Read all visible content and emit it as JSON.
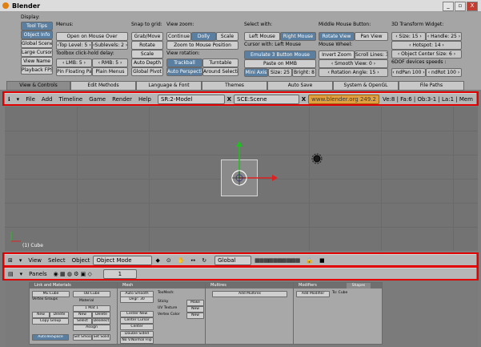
{
  "window": {
    "title": "Blender",
    "buttons": [
      "_",
      "▫",
      "X"
    ]
  },
  "prefs": {
    "display": {
      "label": "Display:",
      "items": [
        "Tool Tips",
        "Object Info",
        "Global Scene",
        "Large Cursors",
        "View Name",
        "Playback FPS"
      ]
    },
    "menus": {
      "label": "Menus:",
      "open_on_mouse_over": "Open on Mouse Over",
      "top_level": "‹Top Level: 5 ›",
      "sublevels": "‹Sublevels: 2 ›",
      "toolbox_label": "Toolbox click-hold delay:",
      "lmb": "‹ LMB: 5 ›",
      "rmb": "‹ RMB: 5 ›",
      "pin_floating": "Pin Floating Pa",
      "plain_menus": "Plain Menus"
    },
    "snap": {
      "label": "Snap to grid:",
      "items": [
        "Grab/Move",
        "Rotate",
        "Scale"
      ],
      "auto_depth": "Auto Depth",
      "global_pivot": "Global Pivot"
    },
    "view_zoom": {
      "label": "View zoom:",
      "items": [
        "Continue",
        "Dolly",
        "Scale"
      ],
      "zoom_to_mouse": "Zoom to Mouse Position",
      "rotation_label": "View rotation:",
      "trackball": "Trackball",
      "turntable": "Turntable",
      "auto_perspective": "Auto Perspecti",
      "around_selection": "Around Selecti"
    },
    "select": {
      "label": "Select with:",
      "left_mouse": "Left Mouse",
      "right_mouse": "Right Mouse",
      "cursor_label": "Cursor with: Left Mouse",
      "emulate3": "Emulate 3 Button Mouse",
      "paste_mmb": "Paste on MMB",
      "mini_axis": "Mini Axis",
      "size": "Size: 25",
      "bright": "Bright: 8"
    },
    "middle": {
      "label": "Middle Mouse Button:",
      "rotate_view": "Rotate View",
      "pan_view": "Pan View",
      "wheel_label": "Mouse Wheel:",
      "invert_zoom": "Invert Zoom",
      "scroll_lines": "Scroll Lines: 3",
      "smooth_view": "‹ Smooth View: 0 ›",
      "rotation_angle": "‹ Rotation Angle: 15 ›"
    },
    "transform": {
      "label": "3D Transform Widget:",
      "size": "‹ Size: 15 ›",
      "handle": "‹ Handle: 25 ›",
      "hotspot": "‹ Hotspot: 14 ›",
      "object_center": "‹ Object Center Size: 6 ›",
      "ndof_label": "6DOF devices speeds :",
      "ndof_pan": "‹ ndPan 100 ›",
      "ndof_rot": "‹ ndRot 100 ›"
    },
    "tabs": [
      "View & Controls",
      "Edit Methods",
      "Language & Font",
      "Themes",
      "Auto Save",
      "System & OpenGL",
      "File Paths"
    ]
  },
  "info_header": {
    "menus": [
      "File",
      "Add",
      "Timeline",
      "Game",
      "Render",
      "Help"
    ],
    "screen": "SR:2-Model",
    "scene": "SCE:Scene",
    "url": "www.blender.org 249.2",
    "stats": "Ve:8 | Fa:6 | Ob:3-1 | La:1 | Mem"
  },
  "viewport": {
    "object_label": "(1) Cube"
  },
  "view3d_header": {
    "menus": [
      "View",
      "Select",
      "Object"
    ],
    "mode": "Object Mode",
    "orientation": "Global"
  },
  "buttons_header": {
    "panels_label": "Panels",
    "frame": "1"
  },
  "buttons": {
    "link_materials": {
      "title": "Link and Materials",
      "me": "ME:Cube",
      "ob": "OB:Cube",
      "vertex_groups": "Vertex Groups",
      "material": "Material",
      "mat_count": "1 Mat 1",
      "new": "New",
      "delete": "Delete",
      "copy_group": "Copy Group",
      "select": "Select",
      "deselect": "Deselect",
      "assign": "Assign",
      "auto_tex": "AutoTexSpace",
      "set_smooth": "Set Smoo",
      "set_solid": "Set Solid"
    },
    "mesh": {
      "title": "Mesh",
      "auto_smooth": "Auto Smooth",
      "degr": "Degr: 30",
      "sticky": "Sticky",
      "uv_texture": "UV Texture",
      "vertex_color": "Vertex Color",
      "make": "Make",
      "new": "New",
      "tex_mesh": "TexMesh:",
      "center_new": "Center New",
      "center_cursor": "Center Cursor",
      "center": "Center",
      "double_sided": "Double Sided",
      "no_vnormal": "No V.Normal Flip"
    },
    "multires": {
      "title": "Multires",
      "add": "Add Multires"
    },
    "modifiers": {
      "title": "Modifiers",
      "shapes": "Shapes",
      "add": "Add Modifier",
      "to": "To: Cube"
    }
  }
}
